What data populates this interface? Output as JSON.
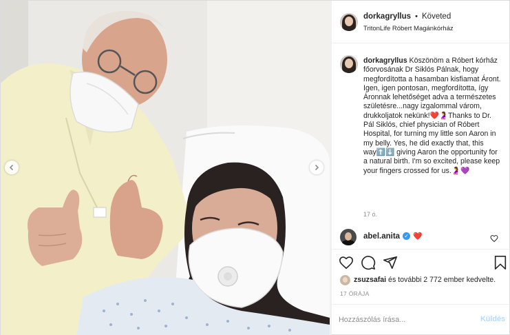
{
  "header": {
    "username": "dorkagryllus",
    "dot": "•",
    "follow_label": "Követed",
    "location": "TritonLife Róbert Magánkórház"
  },
  "caption": {
    "username": "dorkagryllus",
    "text": "Köszönöm a Róbert kórház főorvosának Dr Siklós Pálnak, hogy megfordította a hasamban kisfiamat Áront. Igen, igen pontosan, megfordította, így Áronnak lehetőséget adva a természetes születésre...nagy izgalommal várom, drukkoljatok nekünk!❤️🤰Thanks to Dr. Pál Siklós, chief physician of Róbert Hospital, for turning my little son Aaron in my belly. Yes, he did exactly that, this way⬆️⬇️ giving Aaron the opportunity for a natural birth. I'm so excited, please keep your fingers crossed for us.🤰💜",
    "time": "17 ó."
  },
  "comment": {
    "username": "abel.anita",
    "verified_mark": "✓",
    "text": "❤️"
  },
  "likes": {
    "liker": "zsuzsafai",
    "rest": " és további 2 772 ember kedvelte."
  },
  "post_time": "17 ÓRÁJA",
  "add_comment": {
    "placeholder": "Hozzászólás írása...",
    "send_label": "Küldés"
  },
  "colors": {
    "link_blue": "#3897f0",
    "send_disabled": "#b3dbff",
    "muted": "#8e8e8e",
    "border": "#efefef"
  },
  "icons": [
    "chevron-left-icon",
    "chevron-right-icon",
    "heart-icon",
    "comment-icon",
    "share-icon",
    "bookmark-icon",
    "verified-icon"
  ]
}
